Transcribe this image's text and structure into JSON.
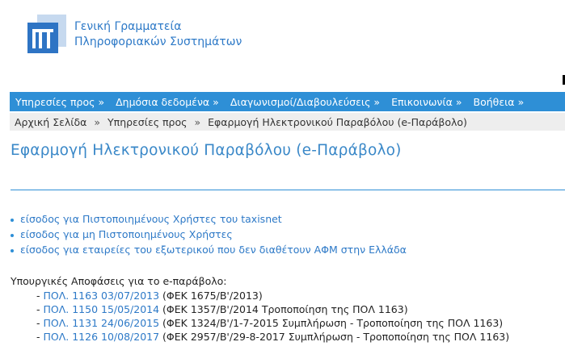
{
  "header": {
    "org_line1": "Γενική Γραμματεία",
    "org_line2": "Πληροφοριακών Συστημάτων",
    "logo_icon": "gsis-logo-icon",
    "brand_color": "#2e8fd6"
  },
  "nav": {
    "items": [
      {
        "label": "Υπηρεσίες προς",
        "arrow": "»"
      },
      {
        "label": "Δημόσια δεδομένα",
        "arrow": "»"
      },
      {
        "label": "Διαγωνισμοί/Διαβουλεύσεις",
        "arrow": "»"
      },
      {
        "label": "Επικοινωνία",
        "arrow": "»"
      },
      {
        "label": "Βοήθεια",
        "arrow": "»"
      }
    ]
  },
  "breadcrumb": {
    "items": [
      "Αρχική Σελίδα",
      "Υπηρεσίες προς",
      "Εφαρμογή Ηλεκτρονικού Παραβόλου (e-Παράβολο)"
    ],
    "separator": "»"
  },
  "page": {
    "title": "Εφαρμογή Ηλεκτρονικού Παραβόλου (e-Παράβολο)"
  },
  "links": [
    "είσοδος για Πιστοποιημένους Χρήστες του taxisnet",
    "είσοδος για μη Πιστοποιημένους Χρήστες",
    "είσοδος για εταιρείες του εξωτερικού που δεν διαθέτουν ΑΦΜ στην Ελλάδα"
  ],
  "decisions": {
    "heading": "Υπουργικές Αποφάσεις για το e-παράβολο:",
    "items": [
      {
        "prefix": "- ",
        "link": "ΠΟΛ. 1163 03/07/2013",
        "desc": " (ΦΕΚ 1675/Β'/2013)"
      },
      {
        "prefix": "- ",
        "link": "ΠΟΛ. 1150 15/05/2014",
        "desc": " (ΦΕΚ 1357/Β'/2014 Τροποποίηση της ΠΟΛ 1163)"
      },
      {
        "prefix": "- ",
        "link": "ΠΟΛ. 1131 24/06/2015",
        "desc": " (ΦΕΚ 1324/Β'/1-7-2015 Συμπλήρωση - Τροποποίηση της ΠΟΛ 1163)"
      },
      {
        "prefix": "- ",
        "link": "ΠΟΛ. 1126 10/08/2017",
        "desc": " (ΦΕΚ 2957/Β'/29-8-2017 Συμπλήρωση - Τροποποίηση της ΠΟΛ 1163)"
      }
    ]
  }
}
